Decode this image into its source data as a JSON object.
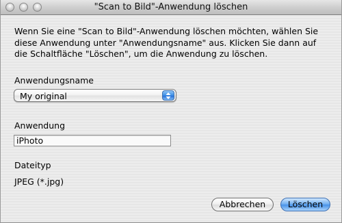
{
  "window": {
    "title": "\"Scan to Bild\"-Anwendung löschen"
  },
  "description": "Wenn Sie eine \"Scan to Bild\"-Anwendung löschen möchten, wählen Sie diese Anwendung unter \"Anwendungsname\" aus. Klicken Sie dann auf die Schaltfläche \"Löschen\", um die Anwendung zu löschen.",
  "application_name": {
    "label": "Anwendungsname",
    "selected": "My original"
  },
  "application": {
    "label": "Anwendung",
    "value": "iPhoto"
  },
  "file_type": {
    "label": "Dateityp",
    "value": "JPEG (*.jpg)"
  },
  "buttons": {
    "cancel": "Abbrechen",
    "delete": "Löschen"
  },
  "colors": {
    "default_button": "#4a93e8",
    "popup_arrows": "#3b8fe6"
  }
}
